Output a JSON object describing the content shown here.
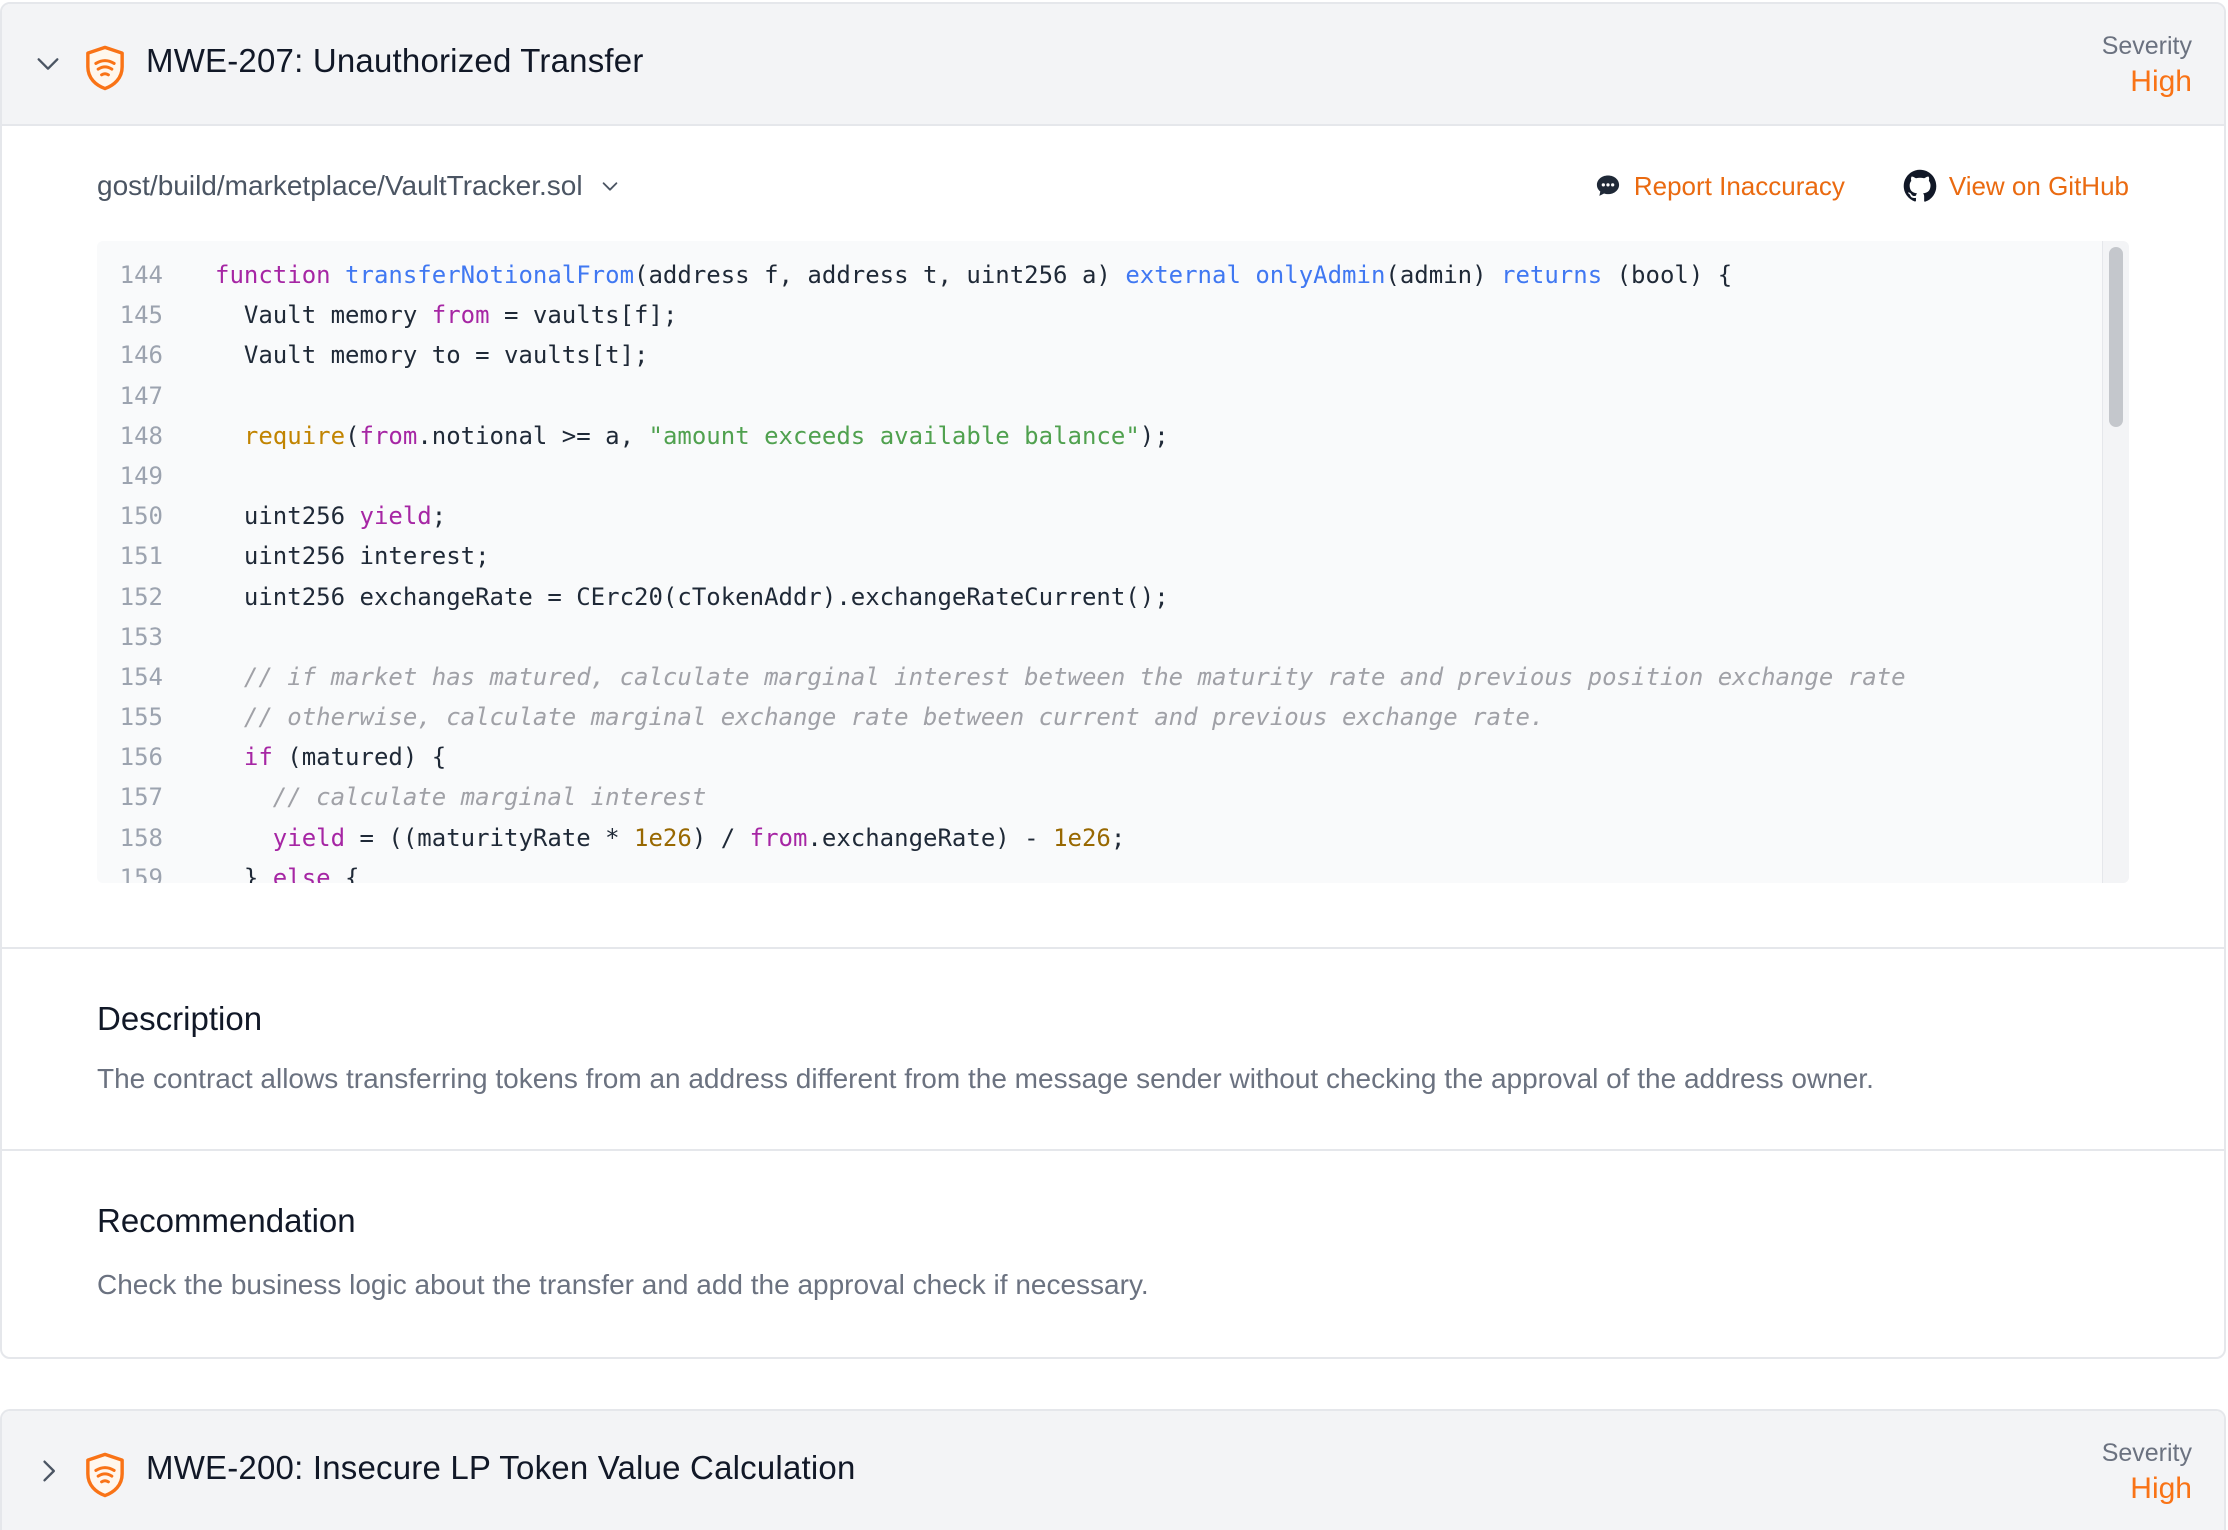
{
  "issues": [
    {
      "id_title": "MWE-207: Unauthorized Transfer",
      "severity_label": "Severity",
      "severity_value": "High",
      "expanded": true,
      "file_path": "gost/build/marketplace/VaultTracker.sol",
      "actions": {
        "report": "Report Inaccuracy",
        "github": "View on GitHub"
      },
      "description_title": "Description",
      "description_text": "The contract allows transferring tokens from an address different from the message sender without checking the approval of the address owner.",
      "recommendation_title": "Recommendation",
      "recommendation_text": "Check the business logic about the transfer and add the approval check if necessary."
    },
    {
      "id_title": "MWE-200: Insecure LP Token Value Calculation",
      "severity_label": "Severity",
      "severity_value": "High",
      "expanded": false
    }
  ],
  "code": [
    {
      "n": "144",
      "t": [
        [
          "kw",
          "function "
        ],
        [
          "fn",
          "transferNotionalFrom"
        ],
        [
          "pl",
          "(address f, address t, uint256 a) "
        ],
        [
          "fn",
          "external"
        ],
        [
          "pl",
          " "
        ],
        [
          "fn",
          "onlyAdmin"
        ],
        [
          "pl",
          "(admin) "
        ],
        [
          "fn",
          "returns"
        ],
        [
          "pl",
          " (bool) {"
        ]
      ]
    },
    {
      "n": "145",
      "t": [
        [
          "pl",
          "  Vault memory "
        ],
        [
          "kw",
          "from"
        ],
        [
          "pl",
          " = vaults[f];"
        ]
      ]
    },
    {
      "n": "146",
      "t": [
        [
          "pl",
          "  Vault memory to = vaults[t];"
        ]
      ]
    },
    {
      "n": "147",
      "t": []
    },
    {
      "n": "148",
      "t": [
        [
          "pl",
          "  "
        ],
        [
          "bi",
          "require"
        ],
        [
          "pl",
          "("
        ],
        [
          "kw",
          "from"
        ],
        [
          "pl",
          ".notional >= a, "
        ],
        [
          "str",
          "\"amount exceeds available balance\""
        ],
        [
          "pl",
          ");"
        ]
      ]
    },
    {
      "n": "149",
      "t": []
    },
    {
      "n": "150",
      "t": [
        [
          "pl",
          "  uint256 "
        ],
        [
          "kw",
          "yield"
        ],
        [
          "pl",
          ";"
        ]
      ]
    },
    {
      "n": "151",
      "t": [
        [
          "pl",
          "  uint256 interest;"
        ]
      ]
    },
    {
      "n": "152",
      "t": [
        [
          "pl",
          "  uint256 exchangeRate = CErc20(cTokenAddr).exchangeRateCurrent();"
        ]
      ]
    },
    {
      "n": "153",
      "t": []
    },
    {
      "n": "154",
      "t": [
        [
          "pl",
          "  "
        ],
        [
          "cm",
          "// if market has matured, calculate marginal interest between the maturity rate and previous position exchange rate"
        ]
      ]
    },
    {
      "n": "155",
      "t": [
        [
          "pl",
          "  "
        ],
        [
          "cm",
          "// otherwise, calculate marginal exchange rate between current and previous exchange rate."
        ]
      ]
    },
    {
      "n": "156",
      "t": [
        [
          "pl",
          "  "
        ],
        [
          "kw",
          "if"
        ],
        [
          "pl",
          " (matured) {"
        ]
      ]
    },
    {
      "n": "157",
      "t": [
        [
          "pl",
          "    "
        ],
        [
          "cm",
          "// calculate marginal interest"
        ]
      ]
    },
    {
      "n": "158",
      "t": [
        [
          "pl",
          "    "
        ],
        [
          "kw",
          "yield"
        ],
        [
          "pl",
          " = ((maturityRate * "
        ],
        [
          "num",
          "1e26"
        ],
        [
          "pl",
          ") / "
        ],
        [
          "kw",
          "from"
        ],
        [
          "pl",
          ".exchangeRate) - "
        ],
        [
          "num",
          "1e26"
        ],
        [
          "pl",
          ";"
        ]
      ]
    },
    {
      "n": "159",
      "t": [
        [
          "pl",
          "  } "
        ],
        [
          "kw",
          "else"
        ],
        [
          "pl",
          " {"
        ]
      ]
    }
  ],
  "colors": {
    "accent": "#f97316",
    "link": "#ea6a10",
    "header_bg": "#f3f4f6",
    "code_bg": "#f9fafb"
  },
  "icons": [
    "chevron-down-icon",
    "shield-icon",
    "comment-icon",
    "github-icon",
    "chevron-right-icon"
  ]
}
